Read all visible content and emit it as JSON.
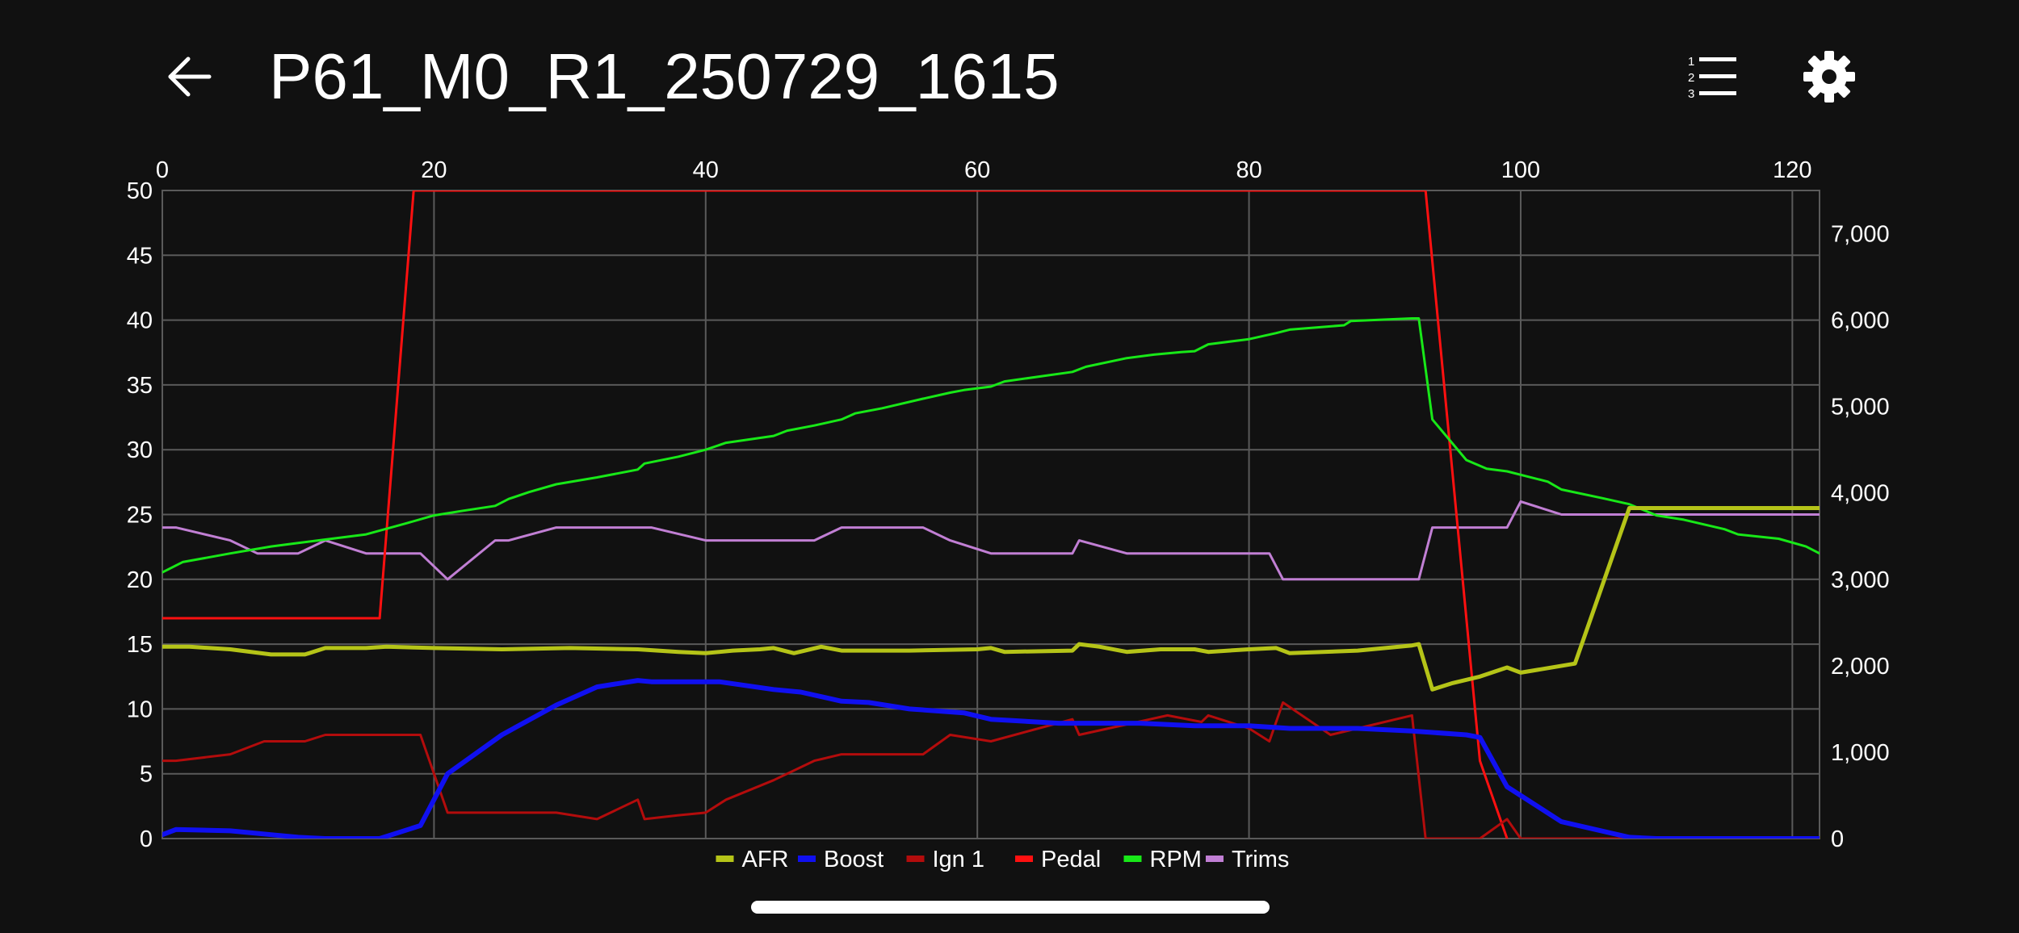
{
  "header": {
    "title": "P61_M0_R1_250729_1615",
    "back_icon": "arrow-left-icon",
    "list_icon": "numbered-list-icon",
    "settings_icon": "gear-icon"
  },
  "colors": {
    "background": "#111111",
    "grid": "#5a5a5a",
    "text": "#ffffff"
  },
  "chart_data": {
    "type": "line",
    "title": "",
    "xlabel": "",
    "ylabel": "",
    "xlim": [
      0,
      122
    ],
    "ylim_left": [
      0,
      50
    ],
    "ylim_right": [
      0,
      7500
    ],
    "x_ticks": [
      0,
      20,
      40,
      60,
      80,
      100,
      120
    ],
    "x_tick_labels": [
      "0",
      "20",
      "40",
      "60",
      "80",
      "100",
      "120"
    ],
    "y_left_ticks": [
      0,
      5,
      10,
      15,
      20,
      25,
      30,
      35,
      40,
      45,
      50
    ],
    "y_left_tick_labels": [
      "0",
      "5",
      "10",
      "15",
      "20",
      "25",
      "30",
      "35",
      "40",
      "45",
      "50"
    ],
    "y_right_ticks": [
      0,
      1000,
      2000,
      3000,
      4000,
      5000,
      6000,
      7000
    ],
    "y_right_tick_labels": [
      "0",
      "1,000",
      "2,000",
      "3,000",
      "4,000",
      "5,000",
      "6,000",
      "7,000"
    ],
    "grid": true,
    "legend_position": "bottom-center",
    "series": [
      {
        "name": "AFR",
        "color": "#b5c418",
        "axis": "left",
        "width": 5,
        "points": [
          [
            0,
            14.8
          ],
          [
            2,
            14.8
          ],
          [
            5,
            14.6
          ],
          [
            8,
            14.2
          ],
          [
            10.5,
            14.2
          ],
          [
            12,
            14.7
          ],
          [
            15,
            14.7
          ],
          [
            16.5,
            14.8
          ],
          [
            20,
            14.7
          ],
          [
            25,
            14.6
          ],
          [
            30,
            14.7
          ],
          [
            35,
            14.6
          ],
          [
            38,
            14.4
          ],
          [
            40,
            14.3
          ],
          [
            42,
            14.5
          ],
          [
            44,
            14.6
          ],
          [
            45,
            14.7
          ],
          [
            46.5,
            14.3
          ],
          [
            48.5,
            14.8
          ],
          [
            50,
            14.5
          ],
          [
            55,
            14.5
          ],
          [
            60,
            14.6
          ],
          [
            61,
            14.7
          ],
          [
            62,
            14.4
          ],
          [
            67,
            14.5
          ],
          [
            67.5,
            15.0
          ],
          [
            69,
            14.8
          ],
          [
            71,
            14.4
          ],
          [
            73.5,
            14.6
          ],
          [
            76,
            14.6
          ],
          [
            77,
            14.4
          ],
          [
            80,
            14.6
          ],
          [
            82,
            14.7
          ],
          [
            83,
            14.3
          ],
          [
            88,
            14.5
          ],
          [
            92,
            14.9
          ],
          [
            92.5,
            15.0
          ],
          [
            93.5,
            11.5
          ],
          [
            95,
            12.0
          ],
          [
            97,
            12.5
          ],
          [
            99,
            13.2
          ],
          [
            100,
            12.8
          ],
          [
            104,
            13.5
          ],
          [
            108,
            25.5
          ],
          [
            122,
            25.5
          ]
        ]
      },
      {
        "name": "Boost",
        "color": "#1010f0",
        "axis": "left",
        "width": 6,
        "points": [
          [
            0,
            0.3
          ],
          [
            1,
            0.7
          ],
          [
            5,
            0.6
          ],
          [
            8,
            0.3
          ],
          [
            10,
            0.1
          ],
          [
            12,
            0.0
          ],
          [
            16,
            0.0
          ],
          [
            19,
            1.0
          ],
          [
            21,
            5.0
          ],
          [
            25,
            8.0
          ],
          [
            29,
            10.3
          ],
          [
            32,
            11.7
          ],
          [
            35,
            12.2
          ],
          [
            36,
            12.1
          ],
          [
            41,
            12.1
          ],
          [
            45,
            11.5
          ],
          [
            47,
            11.3
          ],
          [
            50,
            10.6
          ],
          [
            52,
            10.5
          ],
          [
            55,
            10.0
          ],
          [
            59,
            9.7
          ],
          [
            61,
            9.2
          ],
          [
            66,
            8.9
          ],
          [
            72,
            8.9
          ],
          [
            76,
            8.7
          ],
          [
            80,
            8.7
          ],
          [
            83,
            8.5
          ],
          [
            88,
            8.5
          ],
          [
            92,
            8.3
          ],
          [
            96,
            8.0
          ],
          [
            97,
            7.8
          ],
          [
            99,
            4.0
          ],
          [
            103,
            1.3
          ],
          [
            108,
            0.1
          ],
          [
            110,
            0.0
          ],
          [
            122,
            0.0
          ]
        ]
      },
      {
        "name": "Ign 1",
        "color": "#b30c0c",
        "axis": "left",
        "width": 3,
        "points": [
          [
            0,
            6.0
          ],
          [
            1,
            6.0
          ],
          [
            5,
            6.5
          ],
          [
            7.5,
            7.5
          ],
          [
            10.5,
            7.5
          ],
          [
            12,
            8.0
          ],
          [
            19,
            8.0
          ],
          [
            21,
            2.0
          ],
          [
            25,
            2.0
          ],
          [
            29,
            2.0
          ],
          [
            32,
            1.5
          ],
          [
            35,
            3.0
          ],
          [
            35.5,
            1.5
          ],
          [
            38,
            1.8
          ],
          [
            40,
            2.0
          ],
          [
            41.5,
            3.0
          ],
          [
            45,
            4.5
          ],
          [
            48,
            6.0
          ],
          [
            50,
            6.5
          ],
          [
            56,
            6.5
          ],
          [
            58,
            8.0
          ],
          [
            61,
            7.5
          ],
          [
            67,
            9.2
          ],
          [
            67.5,
            8.0
          ],
          [
            74,
            9.5
          ],
          [
            76.5,
            9.0
          ],
          [
            77,
            9.5
          ],
          [
            80,
            8.5
          ],
          [
            81.5,
            7.5
          ],
          [
            82.5,
            10.5
          ],
          [
            86,
            8.0
          ],
          [
            92,
            9.5
          ],
          [
            93,
            0
          ],
          [
            97,
            0
          ],
          [
            99,
            1.5
          ],
          [
            100,
            0
          ],
          [
            122,
            0
          ]
        ]
      },
      {
        "name": "Pedal",
        "color": "#ff1010",
        "axis": "left",
        "width": 3,
        "points": [
          [
            0,
            17
          ],
          [
            16,
            17
          ],
          [
            18.5,
            50
          ],
          [
            93,
            50
          ],
          [
            97,
            6
          ],
          [
            99,
            0
          ]
        ]
      },
      {
        "name": "RPM",
        "color": "#18e818",
        "axis": "right",
        "width": 3,
        "points": [
          [
            0,
            3080
          ],
          [
            1.5,
            3200
          ],
          [
            5,
            3300
          ],
          [
            8,
            3380
          ],
          [
            10,
            3420
          ],
          [
            12,
            3460
          ],
          [
            15,
            3520
          ],
          [
            18,
            3650
          ],
          [
            20,
            3740
          ],
          [
            22,
            3790
          ],
          [
            24.5,
            3850
          ],
          [
            25.5,
            3930
          ],
          [
            27,
            4010
          ],
          [
            29,
            4100
          ],
          [
            32,
            4180
          ],
          [
            35,
            4270
          ],
          [
            35.5,
            4340
          ],
          [
            38,
            4420
          ],
          [
            40,
            4500
          ],
          [
            41.5,
            4580
          ],
          [
            45,
            4660
          ],
          [
            46,
            4720
          ],
          [
            48,
            4780
          ],
          [
            50,
            4850
          ],
          [
            51,
            4920
          ],
          [
            53,
            4980
          ],
          [
            56,
            5090
          ],
          [
            58,
            5160
          ],
          [
            59,
            5190
          ],
          [
            61,
            5230
          ],
          [
            62,
            5290
          ],
          [
            67,
            5400
          ],
          [
            68,
            5460
          ],
          [
            71,
            5560
          ],
          [
            73,
            5600
          ],
          [
            75,
            5630
          ],
          [
            76,
            5640
          ],
          [
            77,
            5720
          ],
          [
            80,
            5780
          ],
          [
            82,
            5850
          ],
          [
            83,
            5890
          ],
          [
            87,
            5940
          ],
          [
            87.5,
            5990
          ],
          [
            92,
            6020
          ],
          [
            92.5,
            6020
          ],
          [
            93.5,
            4850
          ],
          [
            96,
            4380
          ],
          [
            97.5,
            4280
          ],
          [
            99,
            4250
          ],
          [
            102,
            4130
          ],
          [
            103,
            4040
          ],
          [
            106,
            3940
          ],
          [
            108,
            3870
          ],
          [
            110,
            3740
          ],
          [
            112,
            3690
          ],
          [
            115,
            3580
          ],
          [
            116,
            3520
          ],
          [
            119,
            3470
          ],
          [
            121,
            3380
          ],
          [
            122,
            3300
          ]
        ]
      },
      {
        "name": "Trims",
        "color": "#c17fd4",
        "axis": "left",
        "width": 3,
        "points": [
          [
            0,
            24
          ],
          [
            1,
            24
          ],
          [
            5,
            23
          ],
          [
            7,
            22
          ],
          [
            10,
            22
          ],
          [
            12,
            23
          ],
          [
            15,
            22
          ],
          [
            19,
            22
          ],
          [
            21,
            20
          ],
          [
            24.5,
            23
          ],
          [
            25.5,
            23
          ],
          [
            29,
            24
          ],
          [
            36,
            24
          ],
          [
            40,
            23
          ],
          [
            48,
            23
          ],
          [
            50,
            24
          ],
          [
            56,
            24
          ],
          [
            58,
            23
          ],
          [
            61,
            22
          ],
          [
            67,
            22
          ],
          [
            67.5,
            23
          ],
          [
            71,
            22
          ],
          [
            81.5,
            22
          ],
          [
            82.5,
            20
          ],
          [
            92.5,
            20
          ],
          [
            93.5,
            24
          ],
          [
            99,
            24
          ],
          [
            100,
            26
          ],
          [
            103,
            25
          ],
          [
            122,
            25
          ]
        ]
      }
    ]
  }
}
